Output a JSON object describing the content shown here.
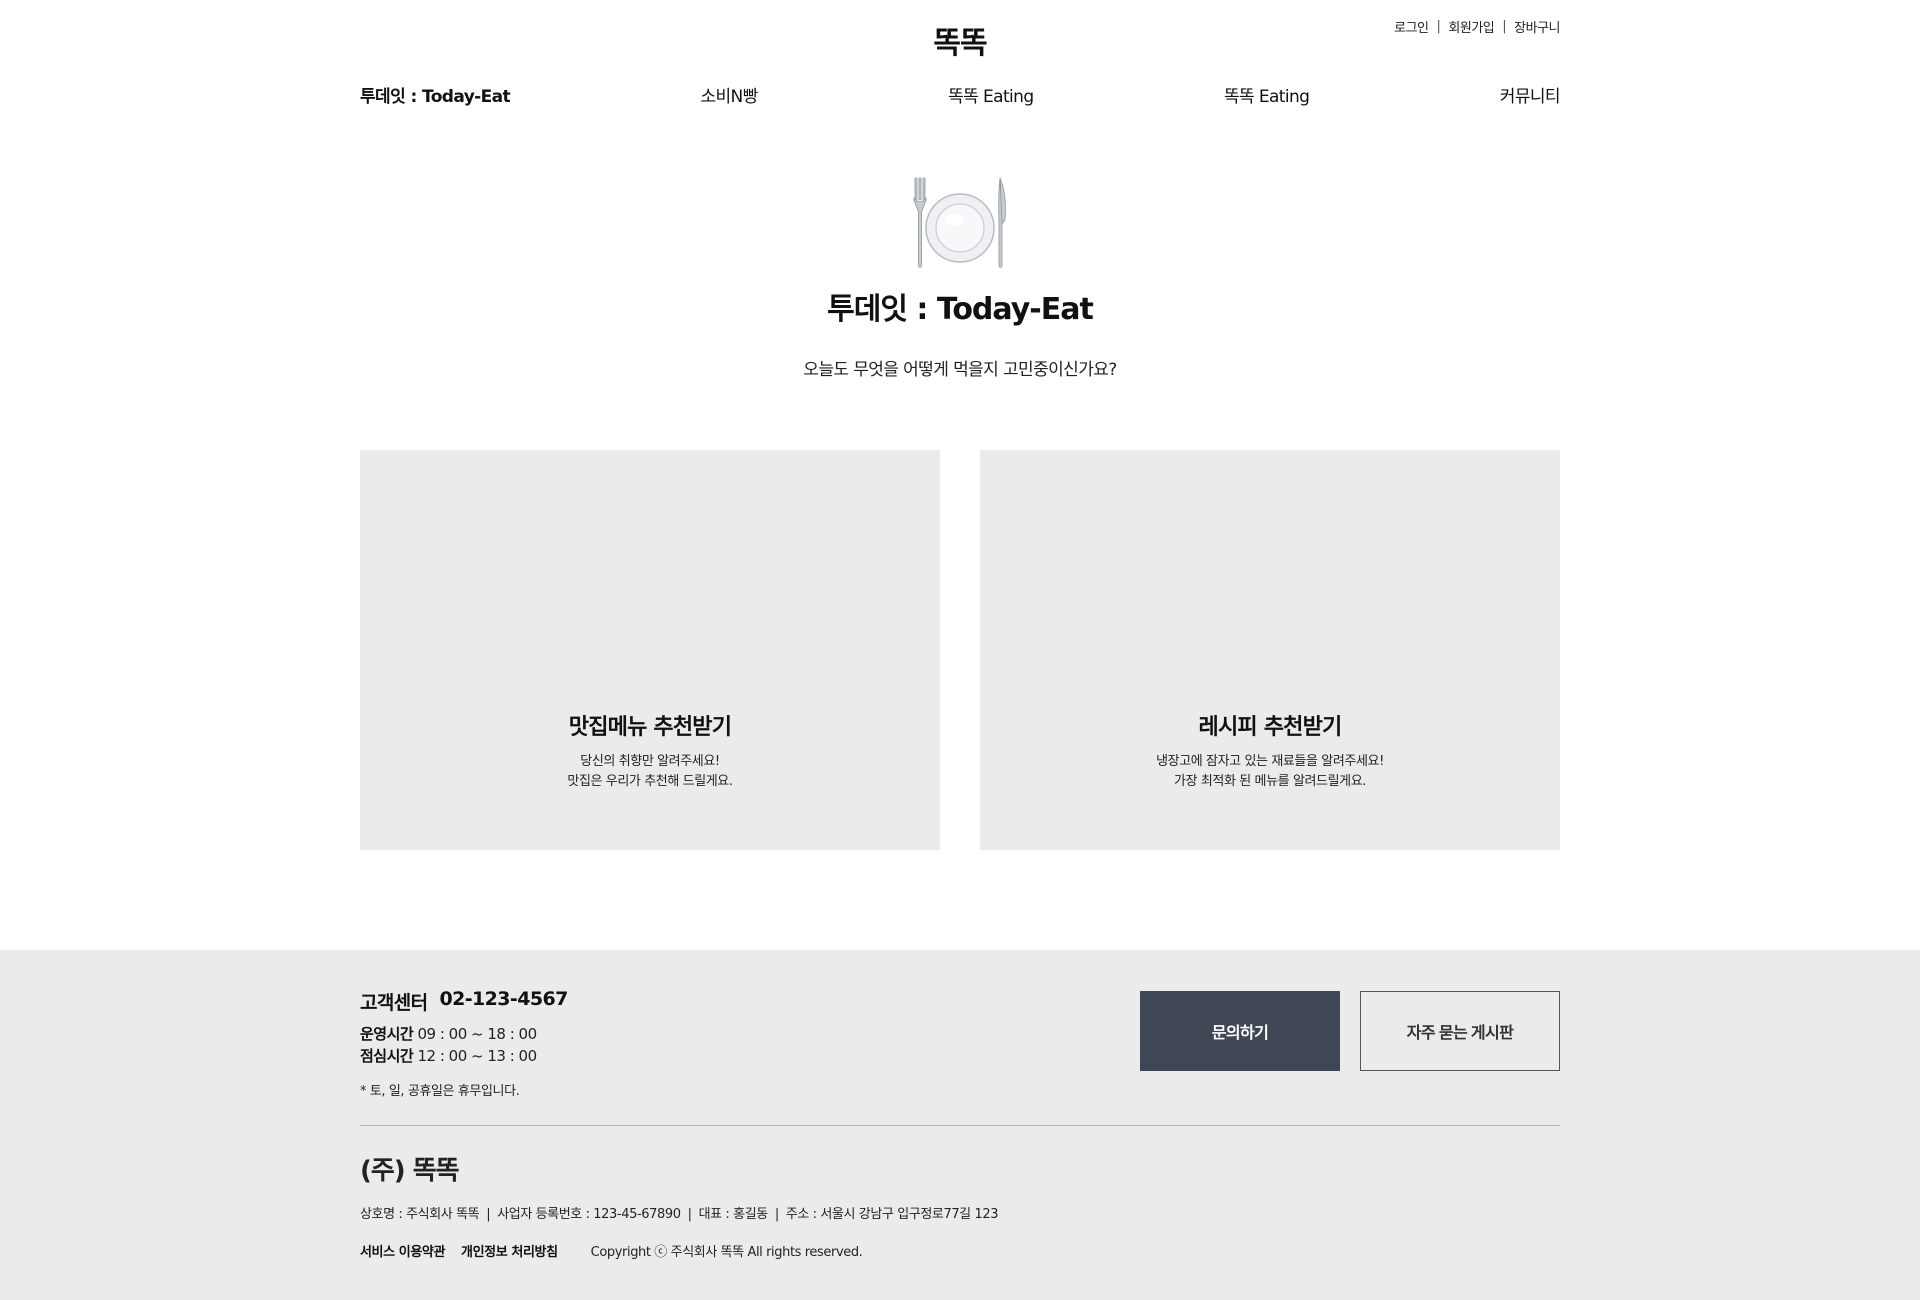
{
  "header": {
    "logo": "똑똑",
    "util": {
      "login": "로그인",
      "signup": "회원가입",
      "cart": "장바구니",
      "separator": "|"
    },
    "nav": [
      {
        "label": "투데잇 : Today-Eat",
        "active": true
      },
      {
        "label": "소비N빵"
      },
      {
        "label": "똑똑 Eating"
      },
      {
        "label": "똑똑 Eating"
      },
      {
        "label": "커뮤니티"
      }
    ]
  },
  "hero": {
    "icon": "fork-knife-plate-icon",
    "title": "투데잇 : Today-Eat",
    "subtitle": "오늘도 무엇을 어떻게 먹을지 고민중이신가요?"
  },
  "cards": [
    {
      "title": "맛집메뉴 추천받기",
      "desc_line1": "당신의 취향만 알려주세요!",
      "desc_line2": "맛집은 우리가 추천해 드릴게요."
    },
    {
      "title": "레시피 추천받기",
      "desc_line1": "냉장고에 잠자고 있는 재료들을 알려주세요!",
      "desc_line2": "가장 최적화 된 메뉴를 알려드릴게요."
    }
  ],
  "footer": {
    "cs_label": "고객센터",
    "cs_phone": "02-123-4567",
    "hours_label": "운영시간",
    "hours_value": "09 : 00 ~ 18 : 00",
    "lunch_label": "점심시간",
    "lunch_value": "12 : 00 ~ 13 : 00",
    "note": "* 토, 일, 공휴일은 휴무입니다.",
    "buttons": {
      "inquiry": "문의하기",
      "faq": "자주 묻는 게시판"
    },
    "company": "(주) 똑똑",
    "biz": {
      "name": "상호명 : 주식회사 똑똑",
      "reg": "사업자 등록번호 : 123-45-67890",
      "ceo": "대표 : 홍길동",
      "address": "주소 : 서울시 강남구 입구정로77길 123"
    },
    "links": {
      "terms": "서비스 이용약관",
      "privacy": "개인정보 처리방침"
    },
    "copyright": "Copyright ⓒ 주식회사 똑똑 All rights reserved."
  },
  "colors": {
    "card_bg": "#ebebeb",
    "footer_bg": "#ebebeb",
    "primary_button": "#3f4755"
  }
}
